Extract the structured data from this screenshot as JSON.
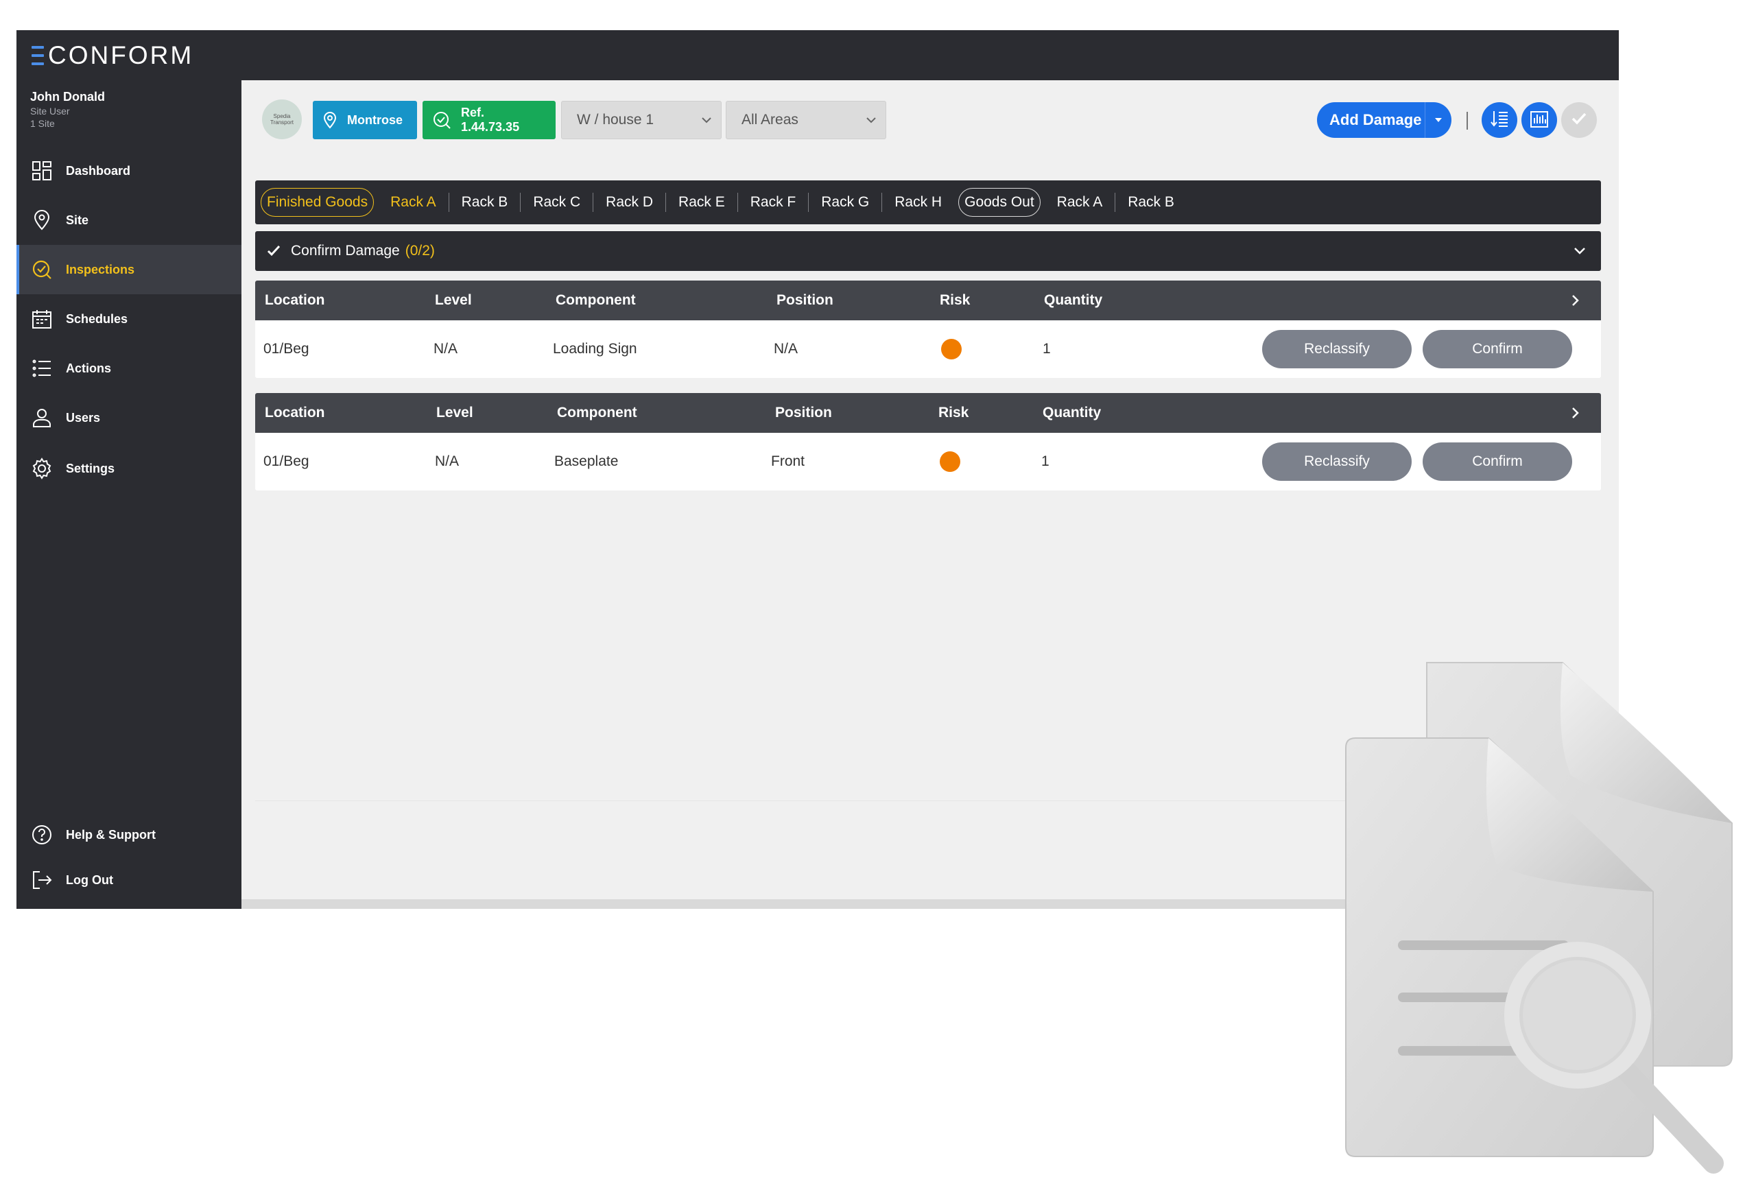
{
  "app": {
    "logo_text": "CONFORM"
  },
  "user": {
    "name": "John Donald",
    "role": "Site User",
    "sites": "1 Site"
  },
  "nav": {
    "items": [
      {
        "label": "Dashboard",
        "icon": "dashboard-icon"
      },
      {
        "label": "Site",
        "icon": "location-pin-icon"
      },
      {
        "label": "Inspections",
        "icon": "inspection-check-icon",
        "active": true
      },
      {
        "label": "Schedules",
        "icon": "calendar-icon"
      },
      {
        "label": "Actions",
        "icon": "list-icon"
      },
      {
        "label": "Users",
        "icon": "user-icon"
      },
      {
        "label": "Settings",
        "icon": "gear-icon"
      }
    ],
    "bottom": [
      {
        "label": "Help & Support",
        "icon": "help-icon"
      },
      {
        "label": "Log Out",
        "icon": "logout-icon"
      }
    ]
  },
  "toolbar": {
    "site_logo_text": "Spedia Transport",
    "site_button": "Montrose",
    "ref_button": "Ref. 1.44.73.35",
    "warehouse_select": "W / house 1",
    "area_select": "All Areas",
    "add_damage": "Add Damage"
  },
  "tabs": {
    "group1": "Finished Goods",
    "group1_items": [
      "Rack A",
      "Rack B",
      "Rack C",
      "Rack D",
      "Rack E",
      "Rack F",
      "Rack G",
      "Rack H"
    ],
    "group2": "Goods Out",
    "group2_items": [
      "Rack A",
      "Rack B"
    ]
  },
  "confirm": {
    "label": "Confirm Damage",
    "count": "(0/2)"
  },
  "table": {
    "headers": [
      "Location",
      "Level",
      "Component",
      "Position",
      "Risk",
      "Quantity"
    ],
    "rows": [
      {
        "location": "01/Beg",
        "level": "N/A",
        "component": "Loading Sign",
        "position": "N/A",
        "risk": "orange",
        "quantity": "1"
      },
      {
        "location": "01/Beg",
        "level": "N/A",
        "component": "Baseplate",
        "position": "Front",
        "risk": "orange",
        "quantity": "1"
      }
    ],
    "reclassify": "Reclassify",
    "confirm": "Confirm"
  },
  "colors": {
    "sidebar_bg": "#2b2c31",
    "accent_gold": "#f2c01b",
    "primary_blue": "#1b6fe8",
    "site_blue": "#1794c8",
    "ref_green": "#17a958",
    "risk_orange": "#f07c00"
  }
}
